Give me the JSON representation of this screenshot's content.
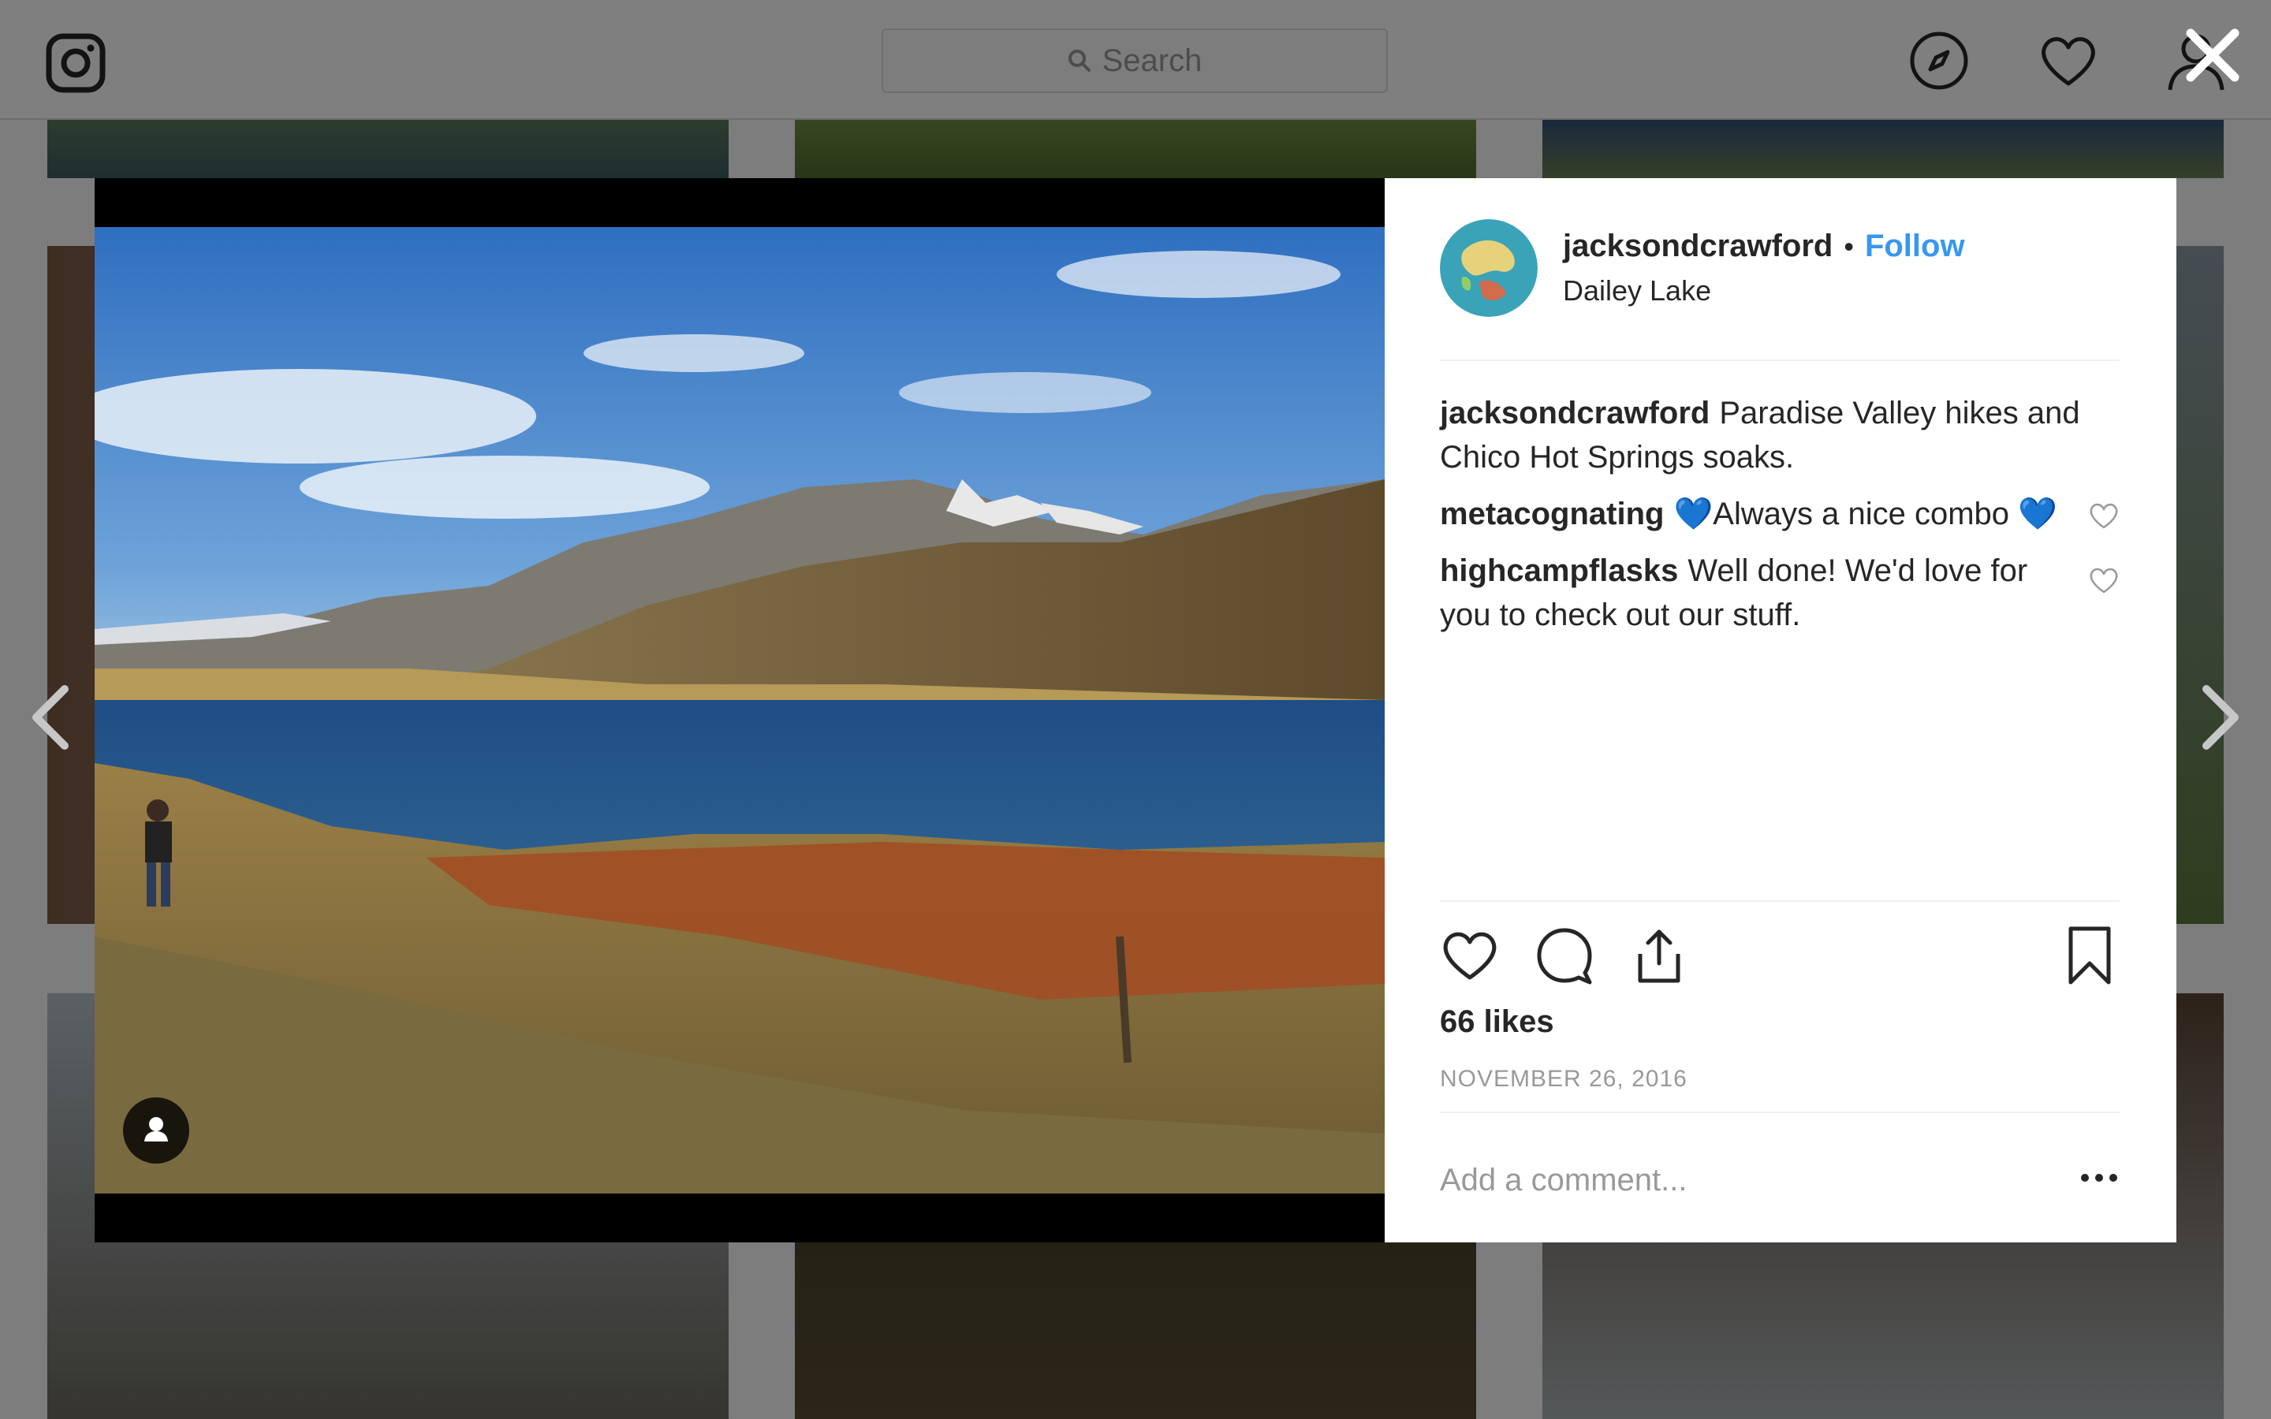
{
  "header": {
    "search_placeholder": "Search",
    "icons": [
      "instagram-logo",
      "search-icon",
      "explore-compass-icon",
      "activity-heart-icon",
      "profile-icon"
    ]
  },
  "overlay": {
    "close_icon": "close-icon",
    "prev_icon": "chevron-left-icon",
    "next_icon": "chevron-right-icon"
  },
  "post": {
    "owner": "jacksondcrawford",
    "separator": "•",
    "follow_label": "Follow",
    "location": "Dailey Lake",
    "caption": {
      "user": "jacksondcrawford",
      "text": "Paradise Valley hikes and Chico Hot Springs soaks."
    },
    "comments": [
      {
        "user": "metacognating",
        "text": "💙Always a nice combo 💙"
      },
      {
        "user": "highcampflasks",
        "text": "Well done! We'd love for you to check out our stuff."
      }
    ],
    "likes": "66 likes",
    "date": "NOVEMBER 26, 2016",
    "add_comment_placeholder": "Add a comment...",
    "action_icons": [
      "like-heart-icon",
      "comment-bubble-icon",
      "share-icon",
      "bookmark-icon"
    ]
  },
  "colors": {
    "accent": "#3897f0",
    "text": "#262626",
    "muted": "#999999",
    "divider": "#efefef"
  }
}
